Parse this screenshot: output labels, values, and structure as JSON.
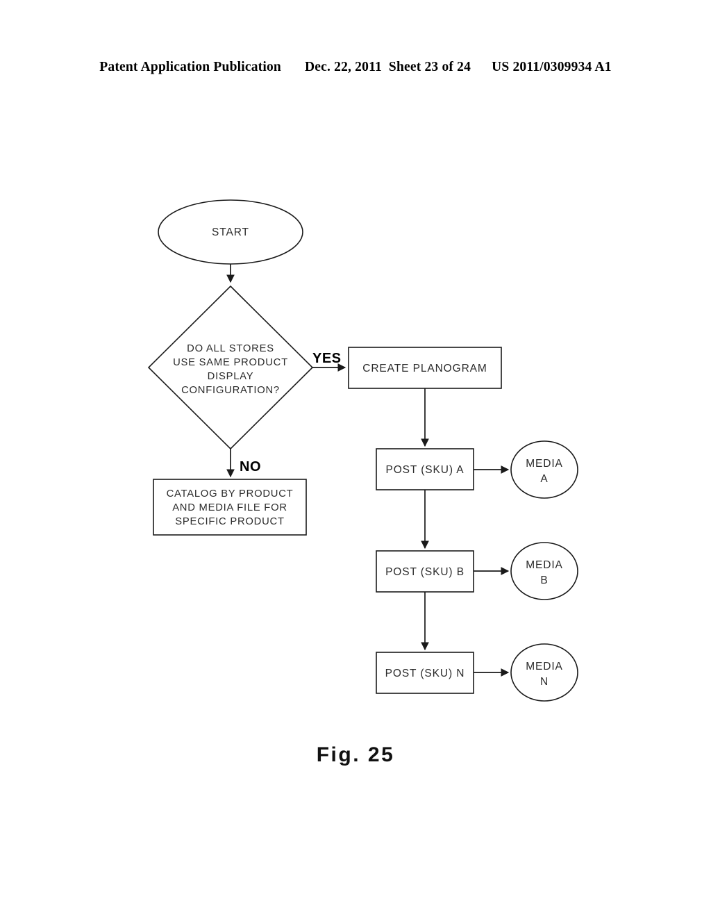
{
  "header": {
    "publication": "Patent Application Publication",
    "date": "Dec. 22, 2011",
    "sheet": "Sheet 23 of 24",
    "number": "US 2011/0309934 A1"
  },
  "figure": {
    "caption": "Fig. 25"
  },
  "flowchart": {
    "start": {
      "label": "START"
    },
    "decision": {
      "line1": "DO ALL STORES",
      "line2": "USE SAME PRODUCT",
      "line3": "DISPLAY",
      "line4": "CONFIGURATION?"
    },
    "branches": {
      "yes": "YES",
      "no": "NO"
    },
    "catalog": {
      "line1": "CATALOG BY PRODUCT",
      "line2": "AND MEDIA FILE FOR",
      "line3": "SPECIFIC PRODUCT"
    },
    "planogram": {
      "label": "CREATE PLANOGRAM"
    },
    "posts": [
      {
        "label": "POST (SKU) A"
      },
      {
        "label": "POST (SKU) B"
      },
      {
        "label": "POST (SKU) N"
      }
    ],
    "media": [
      {
        "line1": "MEDIA",
        "line2": "A"
      },
      {
        "line1": "MEDIA",
        "line2": "B"
      },
      {
        "line1": "MEDIA",
        "line2": "N"
      }
    ]
  },
  "colors": {
    "ink": "#1a1a1a",
    "text": "#2b2b2b",
    "background": "#ffffff"
  }
}
